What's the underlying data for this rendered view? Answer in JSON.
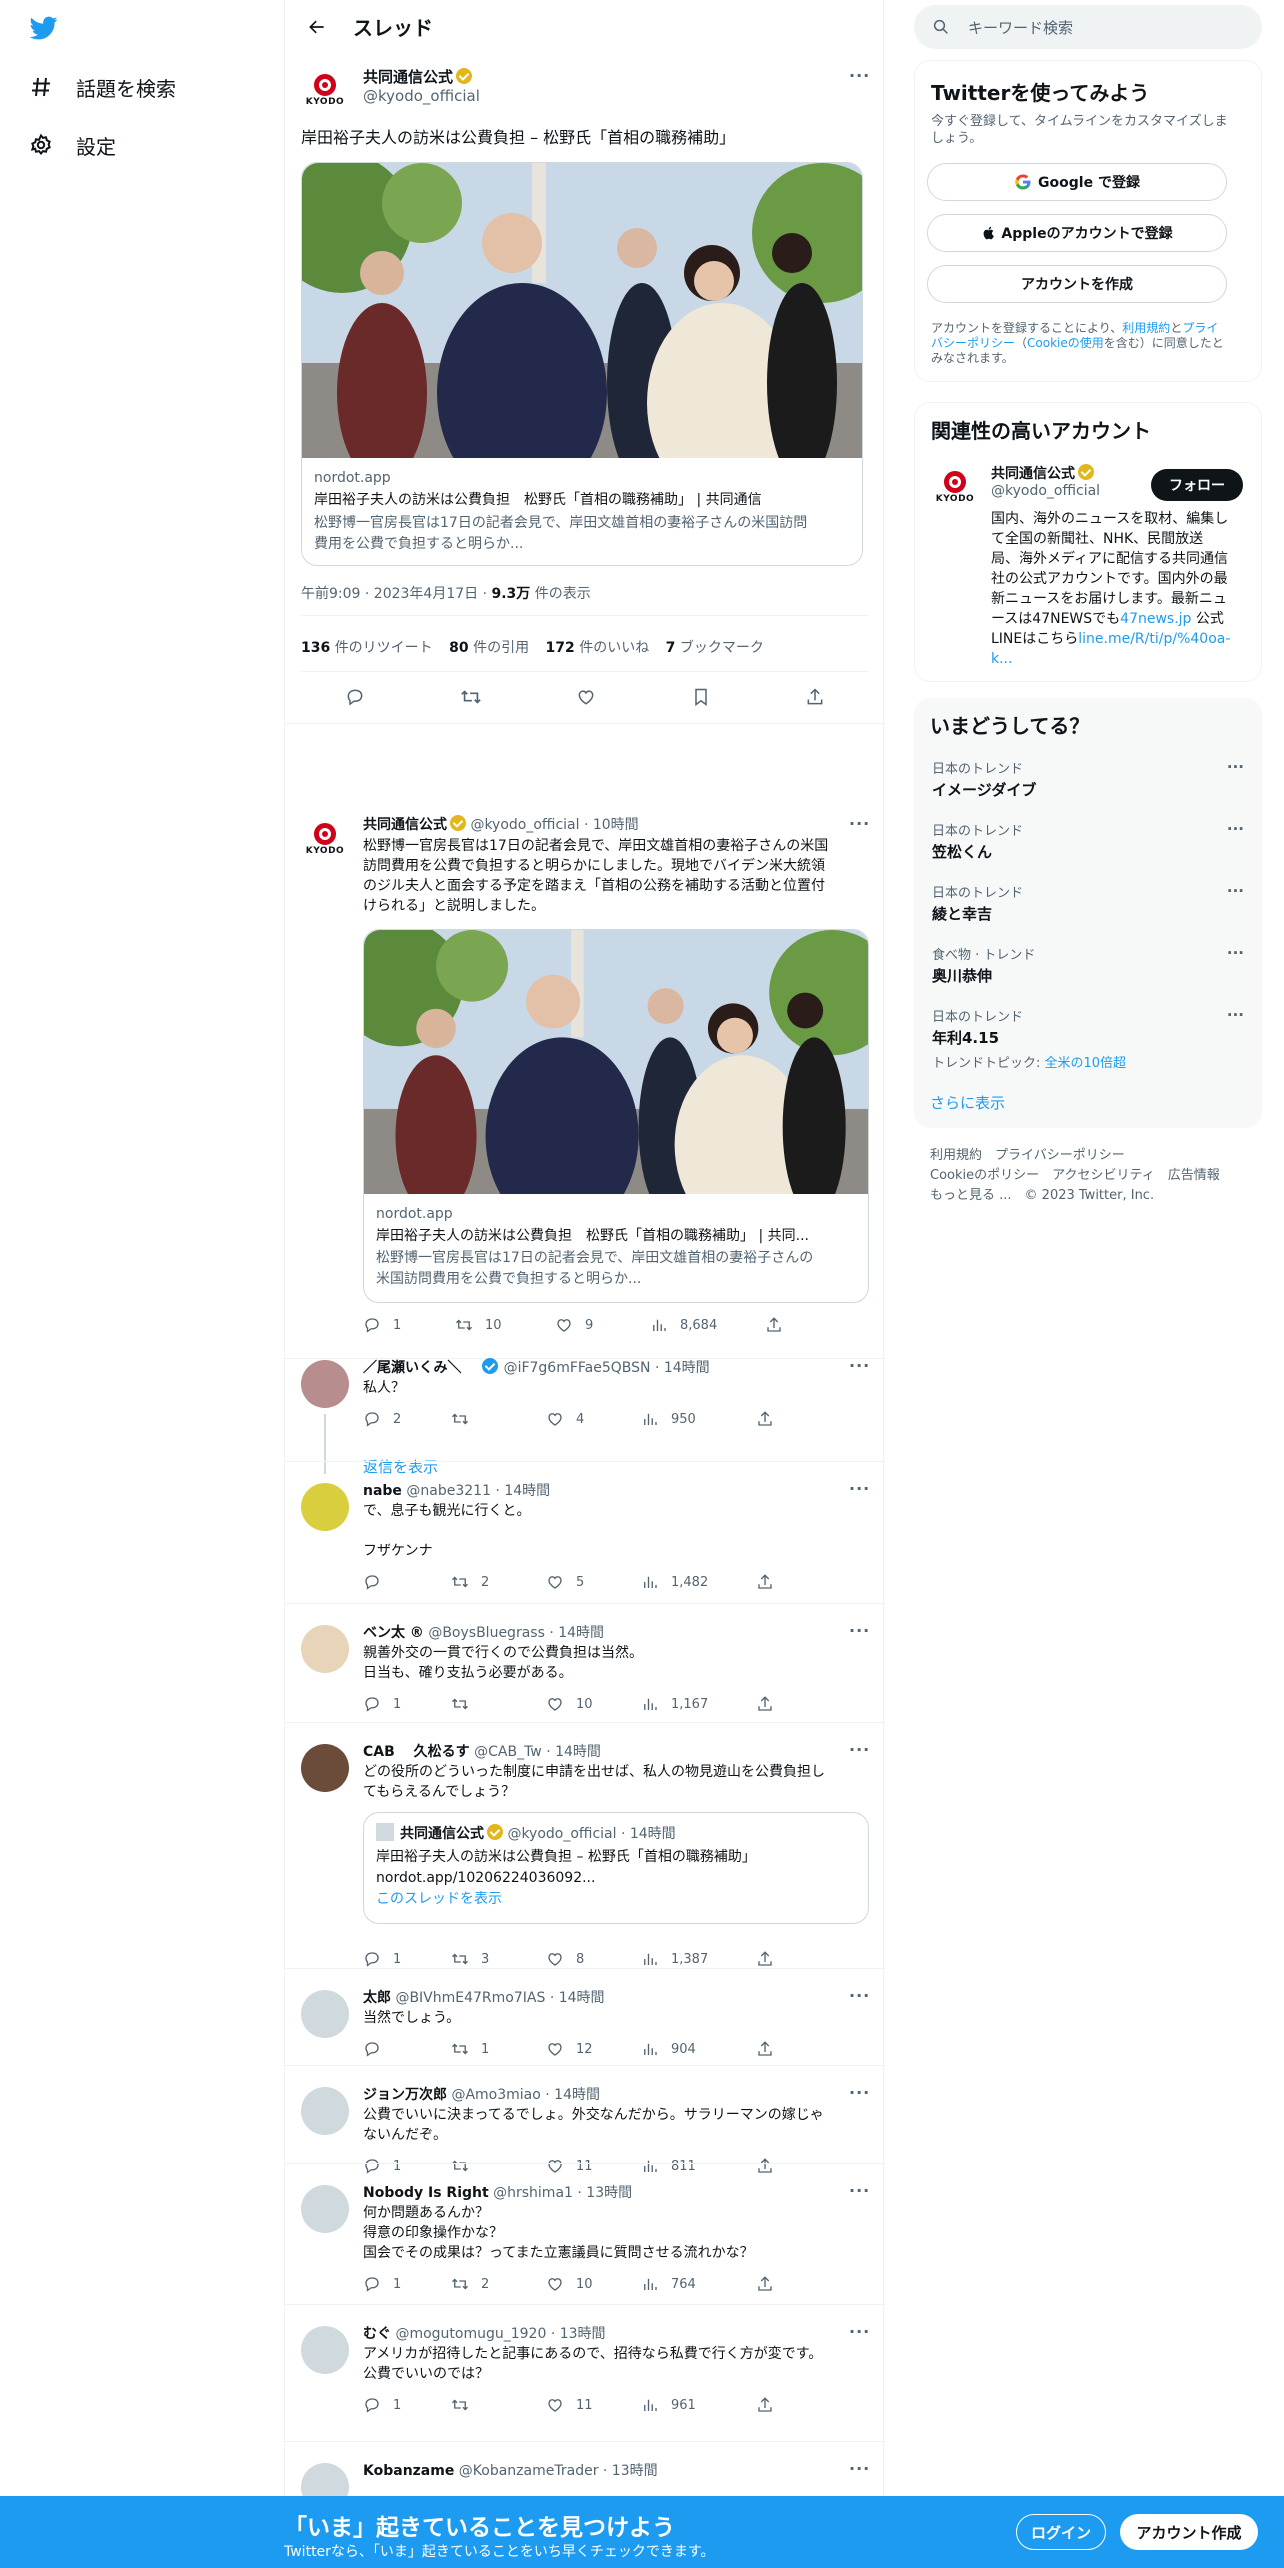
{
  "nav": {
    "explore_label": "話題を検索",
    "settings_label": "設定"
  },
  "header": {
    "title": "スレッド"
  },
  "main_tweet": {
    "author_name": "共同通信公式",
    "author_handle": "@kyodo_official",
    "text": "岸田裕子夫人の訪米は公費負担 – 松野氏「首相の職務補助」",
    "card_domain": "nordot.app",
    "card_title": "岸田裕子夫人の訪米は公費負担　松野氏「首相の職務補助」 | 共同通信",
    "card_desc_1": "松野博一官房長官は17日の記者会見で、岸田文雄首相の妻裕子さんの米国訪問",
    "card_desc_2": "費用を公費で負担すると明らか...",
    "time": "午前9:09 · 2023年4月17日 · ",
    "views_count": "9.3万",
    "views_label": "件の表示",
    "retweets_count": "136",
    "retweets_label": "件のリツイート",
    "quotes_count": "80",
    "quotes_label": "件の引用",
    "likes_count": "172",
    "likes_label": "件のいいね",
    "bookmarks_count": "7",
    "bookmarks_label": "ブックマーク"
  },
  "related_tweet": {
    "author_name": "共同通信公式",
    "author_handle": "@kyodo_official · 10時間",
    "line1": "松野博一官房長官は17日の記者会見で、岸田文雄首相の妻裕子さんの米国",
    "line2": "訪問費用を公費で負担すると明らかにしました。現地でバイデン米大統領",
    "line3": "のジル夫人と面会する予定を踏まえ「首相の公務を補助する活動と位置付",
    "line4": "けられる」と説明しました。",
    "card_domain": "nordot.app",
    "card_title": "岸田裕子夫人の訪米は公費負担　松野氏「首相の職務補助」 | 共同...",
    "card_desc_1": "松野博一官房長官は17日の記者会見で、岸田文雄首相の妻裕子さんの",
    "card_desc_2": "米国訪問費用を公費で負担すると明らか...",
    "replies": "1",
    "retweets": "10",
    "likes": "9",
    "views": "8,684"
  },
  "replies": [
    {
      "name": "／尾瀬いくみ＼",
      "handle": "@iF7g6mFFae5QBSN · 14時間",
      "lines": [
        "私人？"
      ],
      "replies": "2",
      "retweets": "",
      "likes": "4",
      "views": "950",
      "show_replies": "返信を表示"
    },
    {
      "name": "nabe",
      "handle": "@nabe3211 · 14時間",
      "lines": [
        "で、息子も観光に行くと。",
        "",
        "フザケンナ"
      ],
      "replies": "",
      "retweets": "2",
      "likes": "5",
      "views": "1,482"
    },
    {
      "name": "ベン太 ®",
      "handle": "@BoysBluegrass · 14時間",
      "lines": [
        "親善外交の一貫で行くので公費負担は当然。",
        "日当も、確り支払う必要がある。"
      ],
      "replies": "1",
      "retweets": "",
      "likes": "10",
      "views": "1,167"
    },
    {
      "name": "CAB　 久松るす",
      "handle": "@CAB_Tw · 14時間",
      "lines": [
        "どの役所のどういった制度に申請を出せば、私人の物見遊山を公費負担し",
        "てもらえるんでしょう？"
      ],
      "replies": "1",
      "retweets": "3",
      "likes": "8",
      "views": "1,387",
      "quote": {
        "name": "共同通信公式",
        "handle": "@kyodo_official · 14時間",
        "text1": "岸田裕子夫人の訪米は公費負担 – 松野氏「首相の職務補助」",
        "text2": "nordot.app/10206224036092...",
        "thread": "このスレッドを表示"
      }
    },
    {
      "name": "太郎",
      "handle": "@BIVhmE47Rmo7IAS · 14時間",
      "lines": [
        "当然でしょう。"
      ],
      "replies": "",
      "retweets": "1",
      "likes": "12",
      "views": "904"
    },
    {
      "name": "ジョン万次郎",
      "handle": "@Amo3miao · 14時間",
      "lines": [
        "公費でいいに決まってるでしょ。外交なんだから。サラリーマンの嫁じゃ",
        "ないんだぞ。"
      ],
      "replies": "1",
      "retweets": "",
      "likes": "11",
      "views": "811"
    },
    {
      "name": "Nobody Is Right",
      "handle": "@hrshima1 · 13時間",
      "lines": [
        "何か問題あるんか？",
        "得意の印象操作かな？",
        "国会でその成果は？ってまた立憲議員に質問させる流れかな？"
      ],
      "replies": "1",
      "retweets": "2",
      "likes": "10",
      "views": "764"
    },
    {
      "name": "むぐ",
      "handle": "@mogutomugu_1920 · 13時間",
      "lines": [
        "アメリカが招待したと記事にあるので、招待なら私費で行く方が変です。",
        "公費でいいのでは？"
      ],
      "replies": "1",
      "retweets": "",
      "likes": "11",
      "views": "961"
    },
    {
      "name": "Kobanzame",
      "handle": "@KobanzameTrader · 13時間",
      "lines": [],
      "replies": "",
      "retweets": "",
      "likes": "",
      "views": ""
    }
  ],
  "sidebar": {
    "search_placeholder": "キーワード検索",
    "signup": {
      "title": "Twitterを使ってみよう",
      "desc_1": "今すぐ登録して、タイムラインをカスタマイズしま",
      "desc_2": "しょう。",
      "google": "Google で登録",
      "apple": "Appleのアカウントで登録",
      "create": "アカウントを作成",
      "terms_1a": "アカウントを登録することにより、",
      "terms_1b": "利用規約",
      "terms_1c": "と",
      "terms_1d": "プライ",
      "terms_2a": "バシーポリシー",
      "terms_2b": "（",
      "terms_2c": "Cookieの使用",
      "terms_2d": "を含む）に同意したと",
      "terms_3": "みなされます。"
    },
    "related": {
      "title": "関連性の高いアカウント",
      "name": "共同通信公式",
      "handle": "@kyodo_official",
      "follow": "フォロー",
      "bio_1": "国内、海外のニュースを取材、編集し",
      "bio_2": "て全国の新聞社、NHK、民間放送",
      "bio_3": "局、海外メディアに配信する共同通信",
      "bio_4": "社の公式アカウントです。国内外の最",
      "bio_5": "新ニュースをお届けします。最新ニュ",
      "bio_6a": "ースは47NEWSでも",
      "bio_6b": "47news.jp",
      "bio_6c": " 公式",
      "bio_7a": "LINEはこちら",
      "bio_7b": "line.me/R/ti/p/%40oa-",
      "bio_8": "k..."
    },
    "trends": {
      "title": "いまどうしてる？",
      "items": [
        {
          "context": "日本のトレンド",
          "name": "イメージダイブ"
        },
        {
          "context": "日本のトレンド",
          "name": "笠松くん"
        },
        {
          "context": "日本のトレンド",
          "name": "綾と幸吉"
        },
        {
          "context": "食べ物 · トレンド",
          "name": "奥川恭伸"
        },
        {
          "context": "日本のトレンド",
          "name": "年利4.15",
          "extra_a": "トレンドトピック: ",
          "extra_b": "全米の10倍超"
        }
      ],
      "show_more": "さらに表示"
    },
    "footer": {
      "l1a": "利用規約",
      "l1b": "プライバシーポリシー",
      "l2a": "Cookieのポリシー",
      "l2b": "アクセシビリティ",
      "l2c": "広告情報",
      "l3a": "もっと見る ...",
      "l3b": "© 2023 Twitter, Inc."
    }
  },
  "bottom_bar": {
    "title": "「いま」起きていることを見つけよう",
    "subtitle": "Twitterなら、「いま」起きていることをいち早くチェックできます。",
    "login": "ログイン",
    "signup": "アカウント作成"
  },
  "colors": {
    "accent": "#1d9bf0",
    "verified_gold": "#e2b719",
    "kyodo_red": "#d0021b"
  }
}
